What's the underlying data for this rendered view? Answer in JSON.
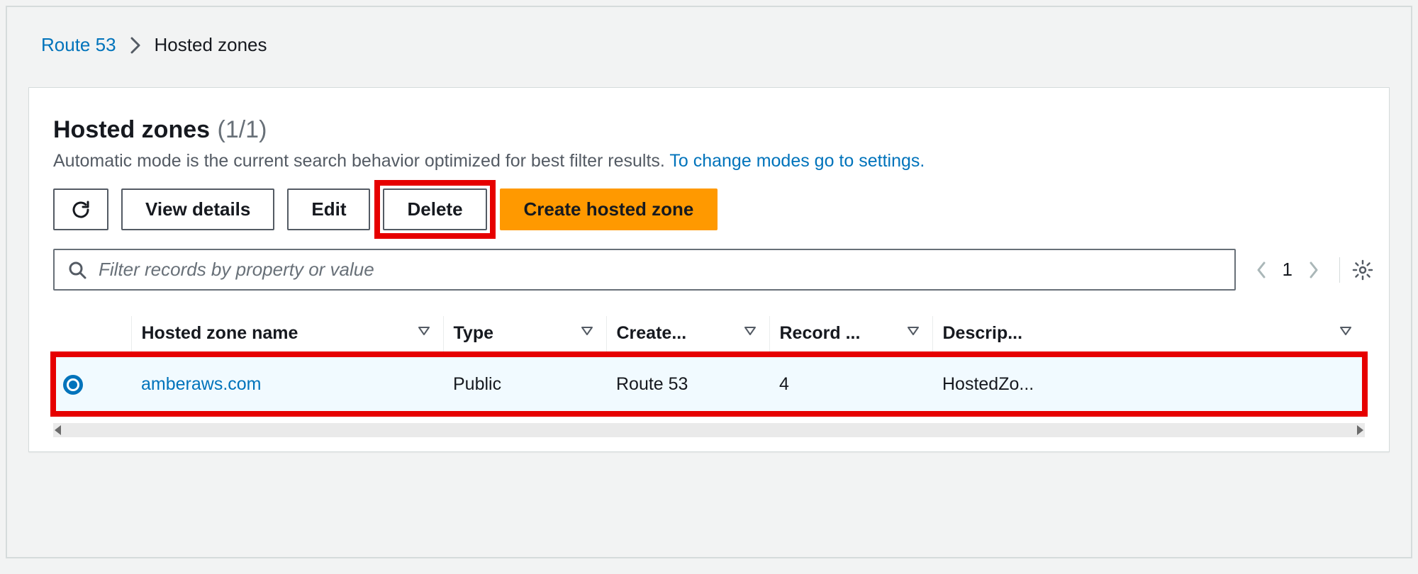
{
  "breadcrumb": {
    "root": "Route 53",
    "current": "Hosted zones"
  },
  "header": {
    "title": "Hosted zones",
    "count": "(1/1)",
    "subtitle_text": "Automatic mode is the current search behavior optimized for best filter results. ",
    "subtitle_link": "To change modes go to settings."
  },
  "buttons": {
    "refresh_icon": "refresh",
    "view_details": "View details",
    "edit": "Edit",
    "delete": "Delete",
    "create": "Create hosted zone"
  },
  "search": {
    "placeholder": "Filter records by property or value",
    "page": "1"
  },
  "table": {
    "columns": {
      "name": "Hosted zone name",
      "type": "Type",
      "created": "Create...",
      "records": "Record ...",
      "description": "Descrip..."
    },
    "rows": [
      {
        "selected": true,
        "name": "amberaws.com",
        "type": "Public",
        "created": "Route 53",
        "records": "4",
        "description": "HostedZo..."
      }
    ]
  }
}
